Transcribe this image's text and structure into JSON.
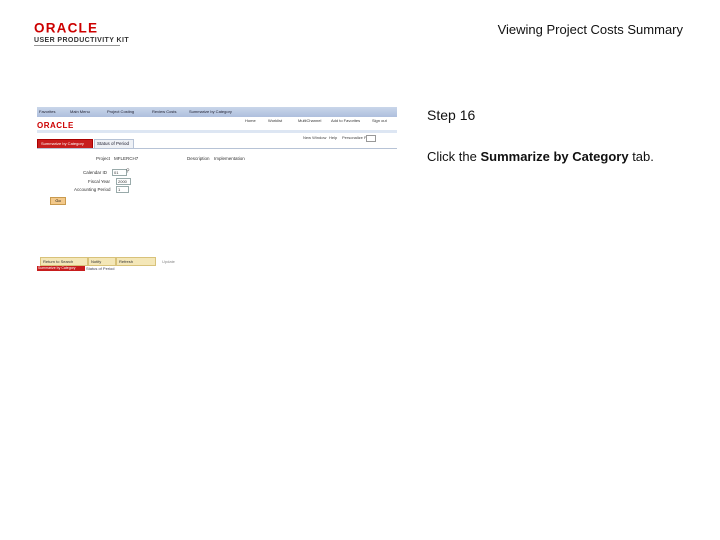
{
  "header": {
    "logo_main": "ORACLE",
    "logo_sub": "USER PRODUCTIVITY KIT",
    "title": "Viewing Project Costs Summary"
  },
  "thumbnail": {
    "navbar": [
      "Favorites",
      "Main Menu",
      "Project Costing",
      "Review Costs",
      "Summarize by Category"
    ],
    "oracle_logo": "ORACLE",
    "header_links": [
      "Home",
      "Worklist",
      "MultiChannel",
      "Add to Favorites",
      "Sign out"
    ],
    "toolbar": [
      "New Window",
      "Help",
      "Personalize Page"
    ],
    "tabs": {
      "active": "Summarize by Category",
      "inactive": "Status of Period"
    },
    "project_label": "Project",
    "project_value": "MFLERCH7",
    "description_label": "Description",
    "description_value": "Implementation",
    "fields": [
      {
        "label": "Calendar ID",
        "value": "01"
      },
      {
        "label": "Fiscal Year",
        "value": "2000"
      },
      {
        "label": "Accounting Period",
        "value": "1"
      }
    ],
    "button": "Go",
    "bottom_buttons": [
      "Return to Search",
      "Notify",
      "Refresh"
    ],
    "bottom_link": "Update",
    "bottom_tabs": {
      "active": "Summarize by Category",
      "inactive": "Status of Period"
    }
  },
  "step": {
    "title": "Step 16",
    "text_prefix": "Click the ",
    "text_bold": "Summarize by Category",
    "text_suffix": " tab."
  },
  "colors": {
    "oracle_red": "#c81d1d",
    "nav_blue": "#aebfdd",
    "button_orange": "#f3c98b"
  }
}
